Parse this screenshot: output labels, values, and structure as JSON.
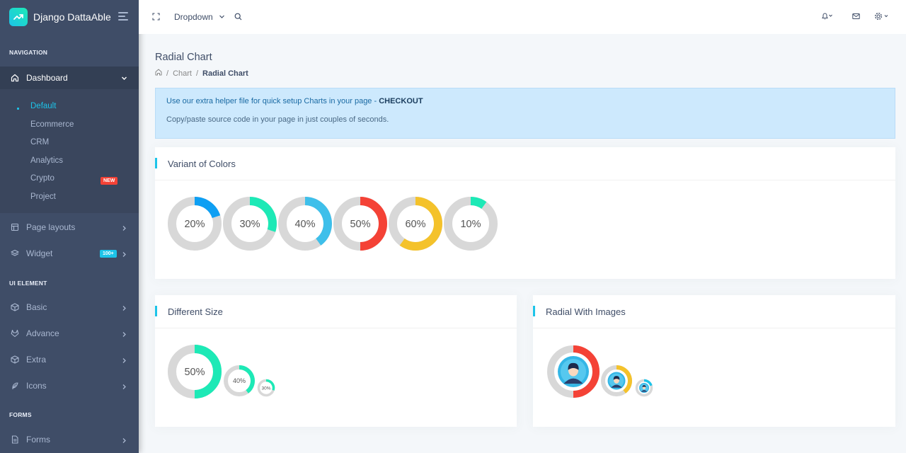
{
  "app": {
    "brand": "Django DattaAble"
  },
  "header": {
    "dropdown_label": "Dropdown"
  },
  "sidebar": {
    "captions": [
      "NAVIGATION",
      "UI ELEMENT",
      "FORMS"
    ],
    "dashboard": "Dashboard",
    "submenu": [
      "Default",
      "Ecommerce",
      "CRM",
      "Analytics",
      "Crypto",
      "Project"
    ],
    "badge_new": "NEW",
    "page_layouts": "Page layouts",
    "widget": "Widget",
    "badge_widget": "100+",
    "basic": "Basic",
    "advance": "Advance",
    "extra": "Extra",
    "icons": "Icons",
    "forms": "Forms"
  },
  "page": {
    "title": "Radial Chart",
    "breadcrumb": [
      "Chart",
      "Radial Chart"
    ]
  },
  "alert": {
    "text": "Use our extra helper file for quick setup Charts in your page - ",
    "link": "CHECKOUT",
    "subtext": "Copy/paste source code in your page in just couples of seconds."
  },
  "cards": {
    "colors_title": "Variant of Colors",
    "size_title": "Different Size",
    "images_title": "Radial With Images"
  },
  "colors": {
    "track": "#d8d8d8",
    "blue": "#1dc4e9",
    "green": "#1de9b6",
    "red": "#f44236",
    "yellow": "#f4c22b",
    "sky": "#0e9ff3"
  },
  "radials": {
    "variants": [
      {
        "value": 20,
        "label": "20%",
        "color": "#0e9ff3"
      },
      {
        "value": 30,
        "label": "30%",
        "color": "#1de9b6"
      },
      {
        "value": 40,
        "label": "40%",
        "color": "#3ebfea"
      },
      {
        "value": 50,
        "label": "50%",
        "color": "#f44236"
      },
      {
        "value": 60,
        "label": "60%",
        "color": "#f4c22b"
      },
      {
        "value": 10,
        "label": "10%",
        "color": "#1de9b6"
      }
    ],
    "sizes": [
      {
        "value": 50,
        "label": "50%",
        "color": "#1de9b6"
      },
      {
        "value": 40,
        "label": "40%",
        "color": "#1de9b6"
      },
      {
        "value": 30,
        "label": "30%",
        "color": "#1de9b6"
      }
    ],
    "images": [
      {
        "value": 50,
        "color": "#f44236"
      },
      {
        "value": 40,
        "color": "#f4c22b"
      },
      {
        "value": 20,
        "color": "#1dc4e9"
      }
    ]
  }
}
